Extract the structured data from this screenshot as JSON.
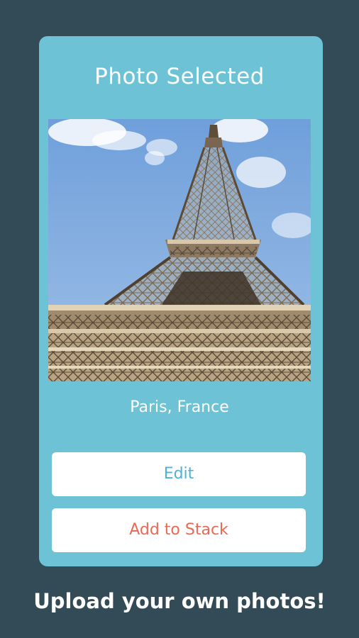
{
  "card": {
    "title": "Photo Selected",
    "location": "Paris, France",
    "edit_label": "Edit",
    "add_label": "Add to Stack"
  },
  "footer": {
    "text": "Upload your own photos!"
  },
  "colors": {
    "background": "#334a57",
    "card": "#6ec2d6",
    "edit_text": "#4db2d6",
    "add_text": "#e86a55"
  }
}
